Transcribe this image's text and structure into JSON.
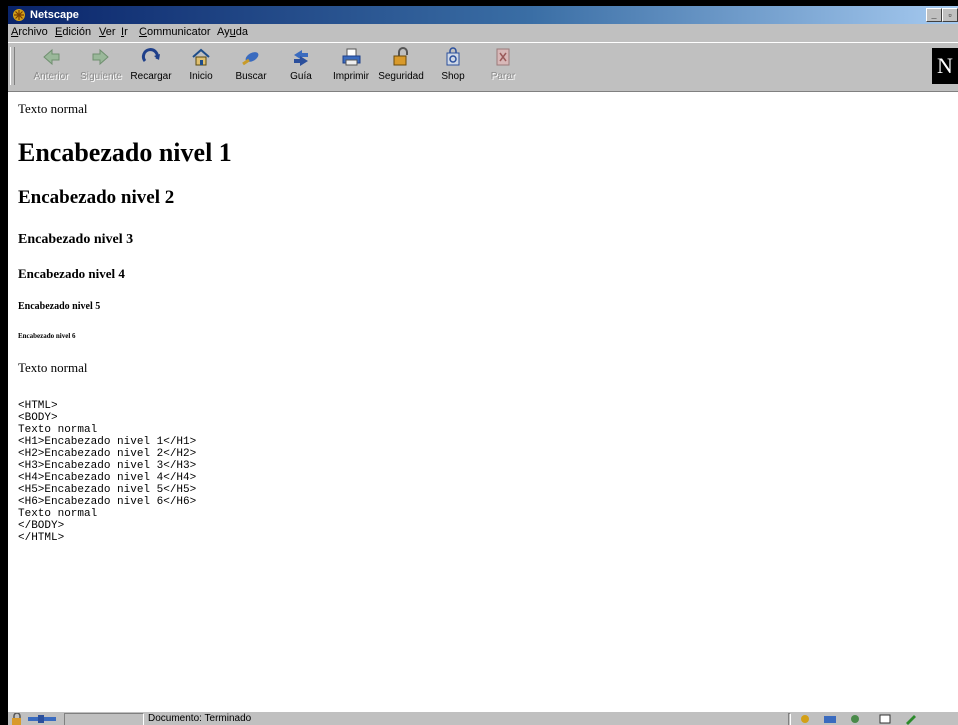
{
  "window": {
    "title": "Netscape"
  },
  "menu": [
    {
      "label": "Archivo",
      "key": "A"
    },
    {
      "label": "Edición",
      "key": "E"
    },
    {
      "label": "Ver",
      "key": "V"
    },
    {
      "label": "Ir",
      "key": "I"
    },
    {
      "label": "Communicator",
      "key": "C"
    },
    {
      "label": "Ayuda",
      "key": "u"
    }
  ],
  "toolbar": {
    "back": {
      "label": "Anterior",
      "enabled": false
    },
    "forward": {
      "label": "Siguiente",
      "enabled": false
    },
    "reload": {
      "label": "Recargar",
      "enabled": true
    },
    "home": {
      "label": "Inicio",
      "enabled": true
    },
    "search": {
      "label": "Buscar",
      "enabled": true
    },
    "guide": {
      "label": "Guía",
      "enabled": true
    },
    "print": {
      "label": "Imprimir",
      "enabled": true
    },
    "security": {
      "label": "Seguridad",
      "enabled": true
    },
    "shop": {
      "label": "Shop",
      "enabled": true
    },
    "stop": {
      "label": "Parar",
      "enabled": false
    }
  },
  "logo": {
    "letter": "N"
  },
  "page": {
    "text_top": "Texto normal",
    "h1": "Encabezado nivel 1",
    "h2": "Encabezado nivel 2",
    "h3": "Encabezado nivel 3",
    "h4": "Encabezado nivel 4",
    "h5": "Encabezado nivel 5",
    "h6": "Encabezado nivel 6",
    "text_bottom": "Texto normal",
    "code": "<HTML>\n<BODY>\nTexto normal\n<H1>Encabezado nivel 1</H1>\n<H2>Encabezado nivel 2</H2>\n<H3>Encabezado nivel 3</H3>\n<H4>Encabezado nivel 4</H4>\n<H5>Encabezado nivel 5</H5>\n<H6>Encabezado nivel 6</H6>\nTexto normal\n</BODY>\n</HTML>"
  },
  "status": {
    "text": "Documento: Terminado"
  },
  "icons": {
    "app": "netscape-icon",
    "back": "back-arrow-icon",
    "forward": "forward-arrow-icon",
    "reload": "reload-icon",
    "home": "home-icon",
    "search": "search-icon",
    "guide": "guide-icon",
    "print": "printer-icon",
    "security": "lock-icon",
    "shop": "shop-icon",
    "stop": "stop-icon"
  }
}
